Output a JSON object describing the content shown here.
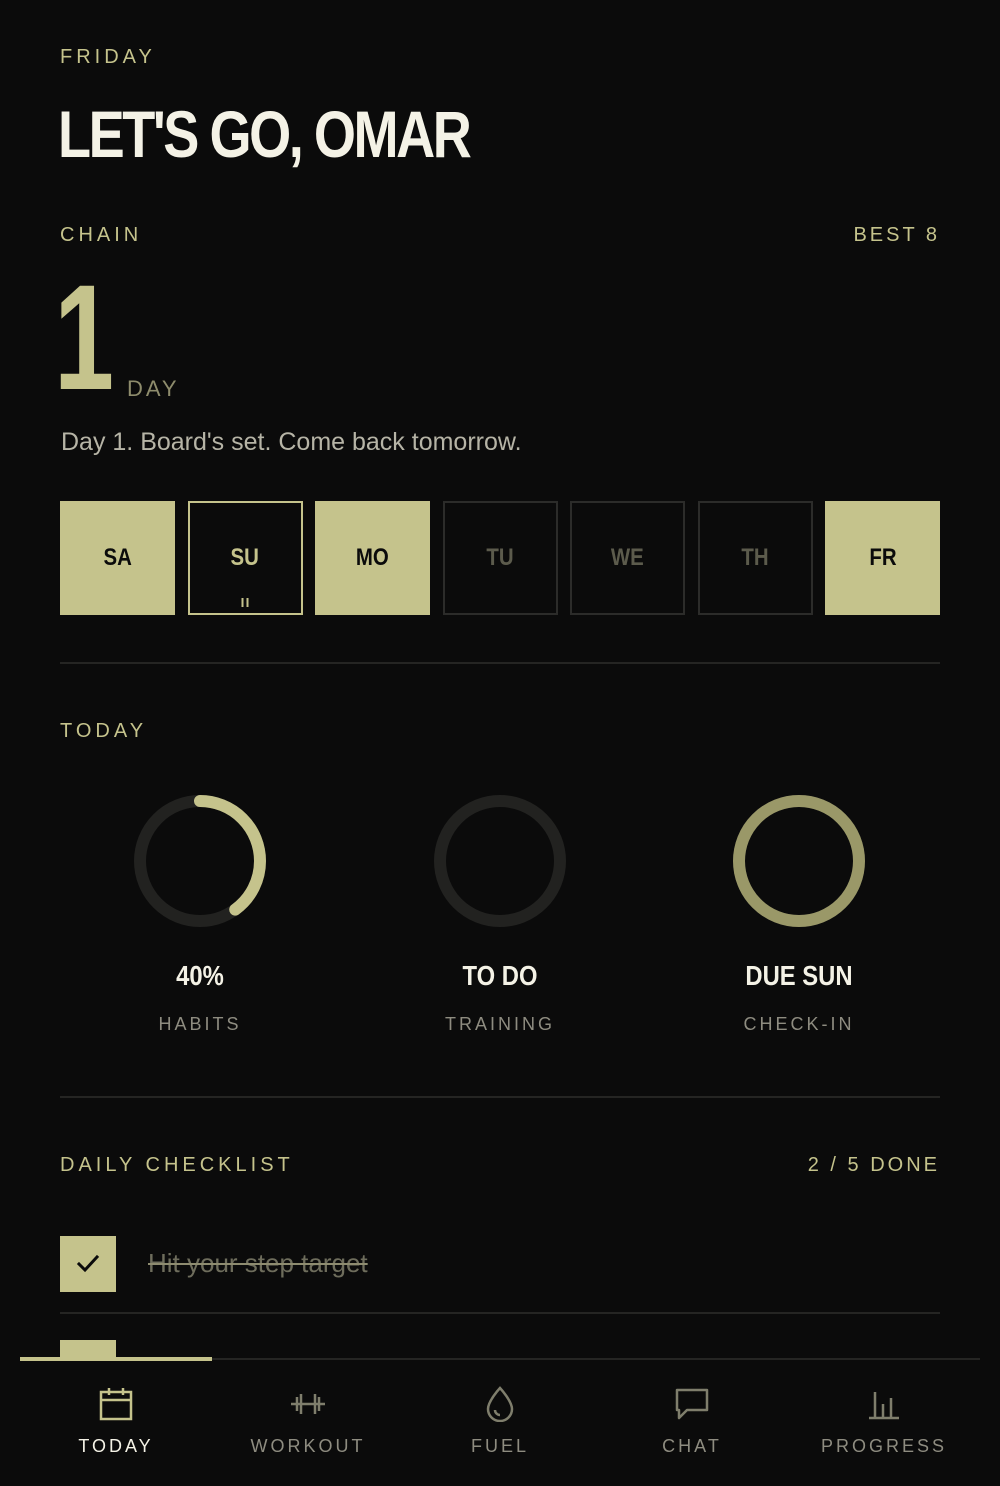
{
  "header": {
    "day": "FRIDAY",
    "greeting": "LET'S GO, OMAR"
  },
  "chain": {
    "label": "CHAIN",
    "best": "BEST 8",
    "count": "1",
    "unit": "DAY",
    "message": "Day 1. Board's set. Come back tomorrow.",
    "week": [
      {
        "label": "SA",
        "state": "done"
      },
      {
        "label": "SU",
        "state": "paused"
      },
      {
        "label": "MO",
        "state": "done"
      },
      {
        "label": "TU",
        "state": "empty"
      },
      {
        "label": "WE",
        "state": "empty"
      },
      {
        "label": "TH",
        "state": "empty"
      },
      {
        "label": "FR",
        "state": "done"
      }
    ]
  },
  "today": {
    "label": "TODAY",
    "rings": [
      {
        "value": "40%",
        "label": "HABITS",
        "progress": 0.4,
        "color": "#c5c38c"
      },
      {
        "value": "TO DO",
        "label": "TRAINING",
        "progress": 0,
        "color": "#c5c38c"
      },
      {
        "value": "DUE SUN",
        "label": "CHECK-IN",
        "progress": 1,
        "color": "#9a9868"
      }
    ]
  },
  "checklist": {
    "label": "DAILY CHECKLIST",
    "summary": "2 / 5 DONE",
    "items": [
      {
        "text": "Hit your step target",
        "done": true
      }
    ]
  },
  "nav": {
    "items": [
      {
        "label": "TODAY",
        "icon": "calendar-icon",
        "active": true
      },
      {
        "label": "WORKOUT",
        "icon": "dumbbell-icon",
        "active": false
      },
      {
        "label": "FUEL",
        "icon": "drop-icon",
        "active": false
      },
      {
        "label": "CHAT",
        "icon": "chat-bubble-icon",
        "active": false
      },
      {
        "label": "PROGRESS",
        "icon": "bar-chart-icon",
        "active": false
      }
    ]
  },
  "colors": {
    "accent": "#c5c38c",
    "background": "#0b0b0b",
    "text": "#f4f2e6",
    "muted": "#8e8c80"
  }
}
